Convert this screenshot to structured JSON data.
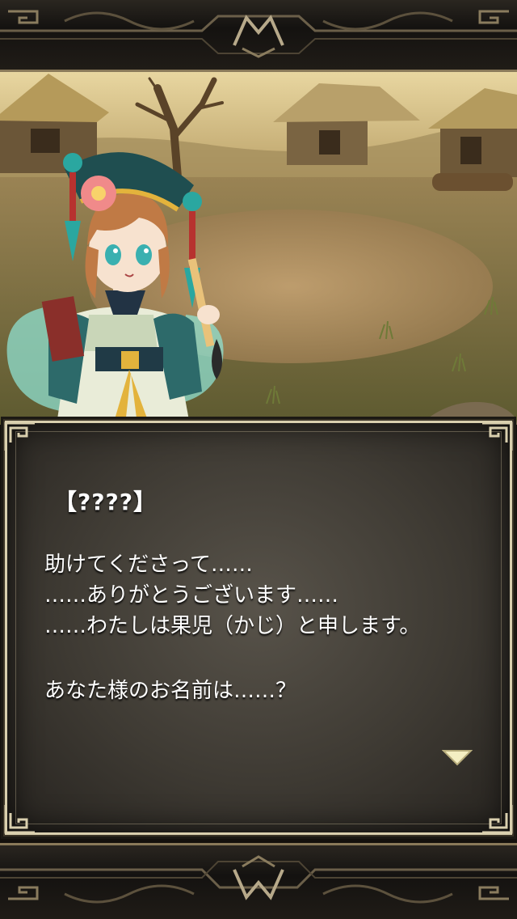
{
  "dialogue": {
    "speaker": "【????】",
    "lines": [
      "助けてくださって……",
      "……ありがとうございます……",
      "……わたしは果児（かじ）と申します。",
      "",
      "あなた様のお名前は……？"
    ]
  },
  "icons": {
    "advance": "triangle-down-icon",
    "frame_emblem": "ornament-emblem-icon"
  },
  "colors": {
    "text": "#ffffff",
    "frame_border": "#d9cfae",
    "dialog_bg": "#3e3a33",
    "advance_arrow": "#f4eec2"
  }
}
